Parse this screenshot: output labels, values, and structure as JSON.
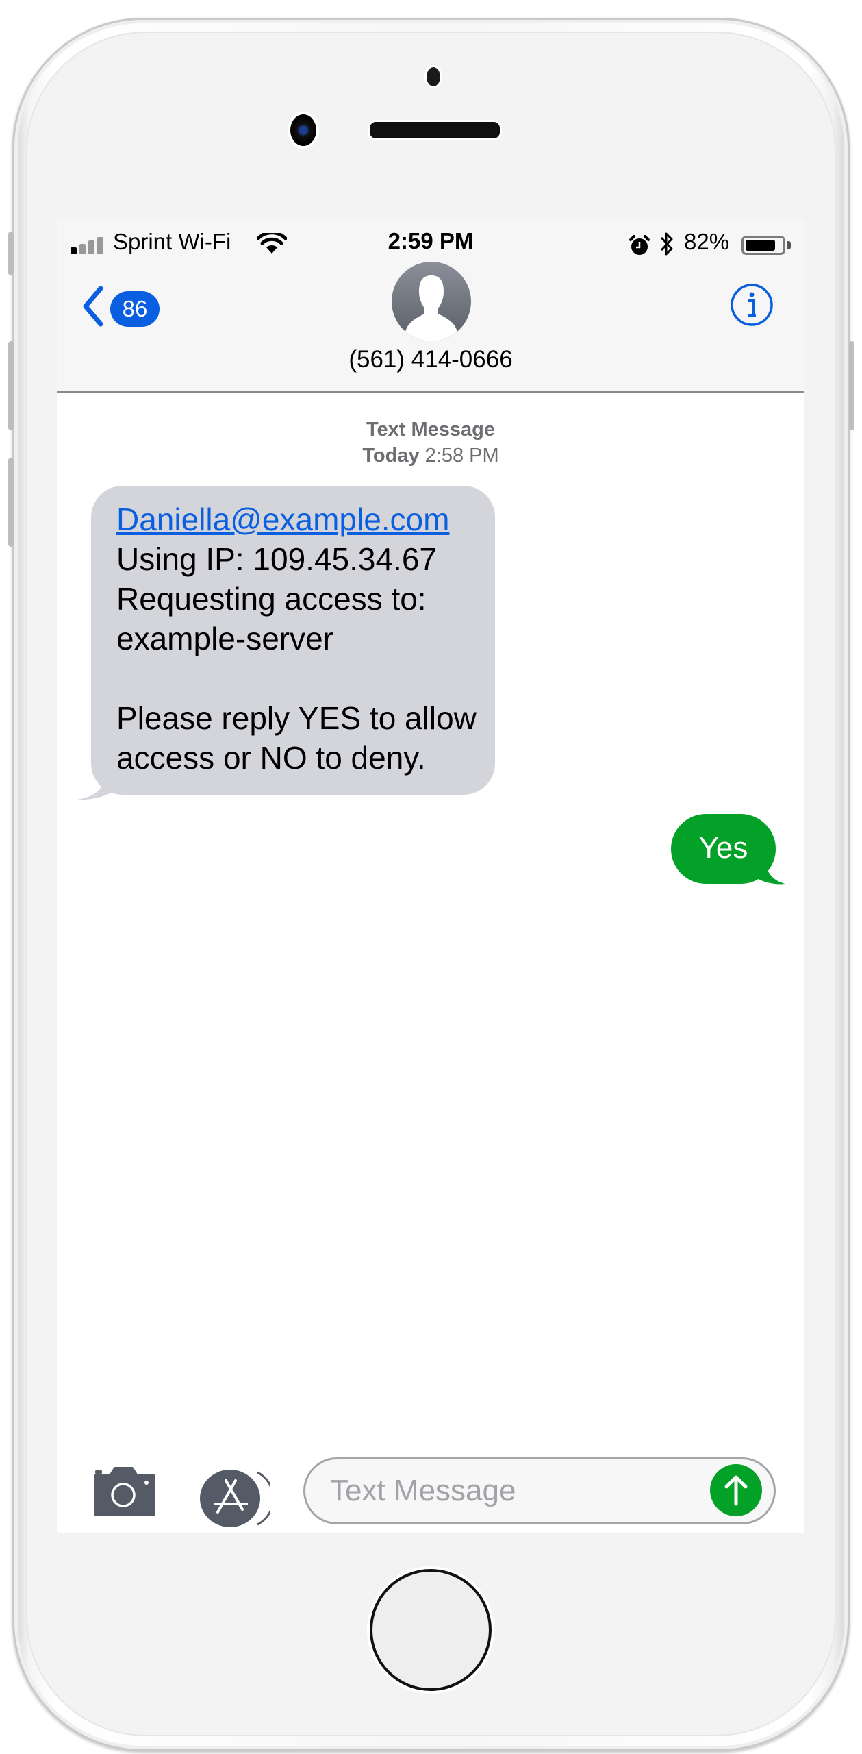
{
  "status_bar": {
    "signal_bars_filled": 1,
    "signal_bars_total": 4,
    "carrier": "Sprint Wi-Fi",
    "wifi_icon": "wifi-icon",
    "time": "2:59 PM",
    "alarm_icon": "alarm-clock-icon",
    "bluetooth_icon": "bluetooth-icon",
    "battery_percent_label": "82%",
    "battery_level": 0.82
  },
  "nav": {
    "back_icon": "chevron-left-icon",
    "unread_count": "86",
    "avatar_icon": "person-silhouette-icon",
    "contact": "(561) 414-0666",
    "info_icon": "info-circle-icon"
  },
  "conversation": {
    "service_label": "Text Message",
    "day_label": "Today",
    "time_label": "2:58 PM",
    "messages": [
      {
        "direction": "incoming",
        "link": "Daniella@example.com",
        "body": "Using IP: 109.45.34.67\nRequesting access to:\nexample-server\n\nPlease reply YES to allow access or NO to deny."
      },
      {
        "direction": "outgoing",
        "body": "Yes"
      }
    ]
  },
  "composer": {
    "camera_icon": "camera-icon",
    "apps_icon": "app-store-icon",
    "placeholder": "Text Message",
    "value": "",
    "send_icon": "arrow-up-icon"
  },
  "colors": {
    "accent_blue": "#0a5fe0",
    "sms_green": "#04a128",
    "incoming_bubble": "#d4d4db"
  }
}
